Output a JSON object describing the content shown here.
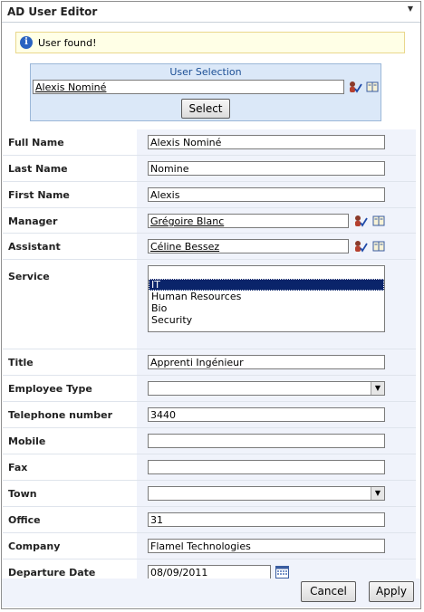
{
  "window": {
    "title": "AD User Editor"
  },
  "notice": {
    "message": "User found!"
  },
  "user_selection": {
    "caption": "User Selection",
    "value": "Alexis Nominé",
    "select_label": "Select"
  },
  "fields": {
    "full_name": {
      "label": "Full Name",
      "value": "Alexis Nominé"
    },
    "last_name": {
      "label": "Last Name",
      "value": "Nomine"
    },
    "first_name": {
      "label": "First Name",
      "value": "Alexis"
    },
    "manager": {
      "label": "Manager",
      "value": "Grégoire Blanc"
    },
    "assistant": {
      "label": "Assistant",
      "value": "Céline Bessez"
    },
    "service": {
      "label": "Service",
      "options": [
        "IT",
        "Human Resources",
        "Bio",
        "Security"
      ],
      "selected": "IT"
    },
    "title": {
      "label": "Title",
      "value": "Apprenti Ingénieur"
    },
    "employee_type": {
      "label": "Employee Type",
      "value": ""
    },
    "telephone": {
      "label": "Telephone number",
      "value": "3440"
    },
    "mobile": {
      "label": "Mobile",
      "value": ""
    },
    "fax": {
      "label": "Fax",
      "value": ""
    },
    "town": {
      "label": "Town",
      "value": ""
    },
    "office": {
      "label": "Office",
      "value": "31"
    },
    "company": {
      "label": "Company",
      "value": "Flamel Technologies"
    },
    "departure_date": {
      "label": "Departure Date",
      "value": "08/09/2011"
    }
  },
  "buttons": {
    "cancel": "Cancel",
    "apply": "Apply"
  },
  "icons": {
    "check_names": "check-names-icon",
    "address_book": "address-book-icon",
    "calendar": "calendar-icon",
    "info": "info-icon",
    "menu": "chevron-down-icon"
  }
}
